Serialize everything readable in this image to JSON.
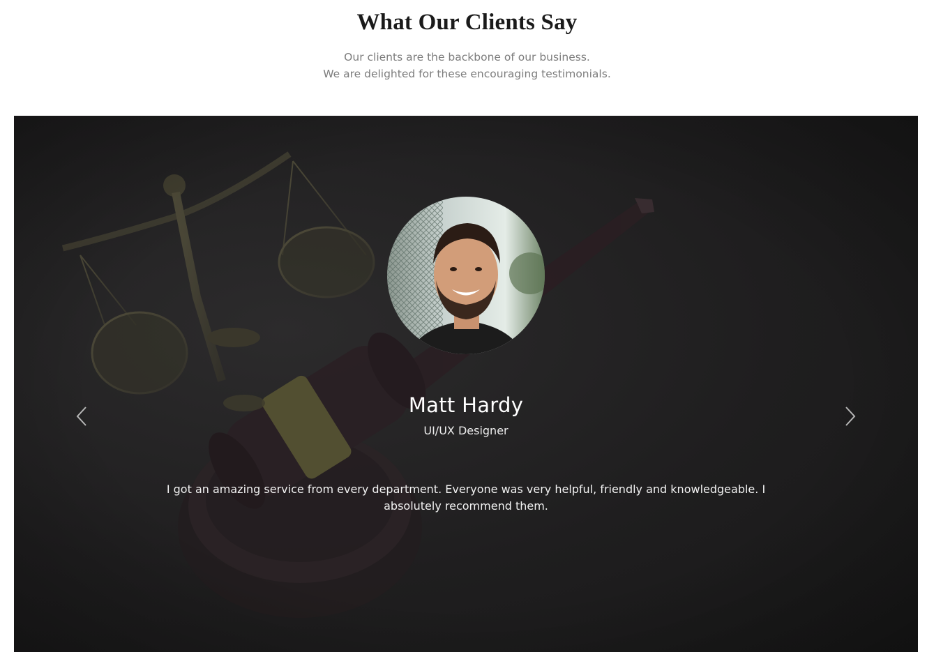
{
  "section": {
    "title": "What Our Clients Say",
    "subtitle_lines": [
      "Our clients are the backbone of our business.",
      "We are delighted for these encouraging testimonials."
    ]
  },
  "testimonial": {
    "name": "Matt Hardy",
    "role": "UI/UX Designer",
    "quote": "I got an amazing service from every department. Everyone was very helpful, friendly and knowledgeable. I absolutely recommend them."
  },
  "carousel": {
    "prev_icon": "chevron-left-icon",
    "next_icon": "chevron-right-icon"
  },
  "colors": {
    "title": "#1a1a1a",
    "subtitle": "#7d7d7d",
    "hero_background": "#1f1e1f",
    "text_on_dark": "#ffffff"
  }
}
